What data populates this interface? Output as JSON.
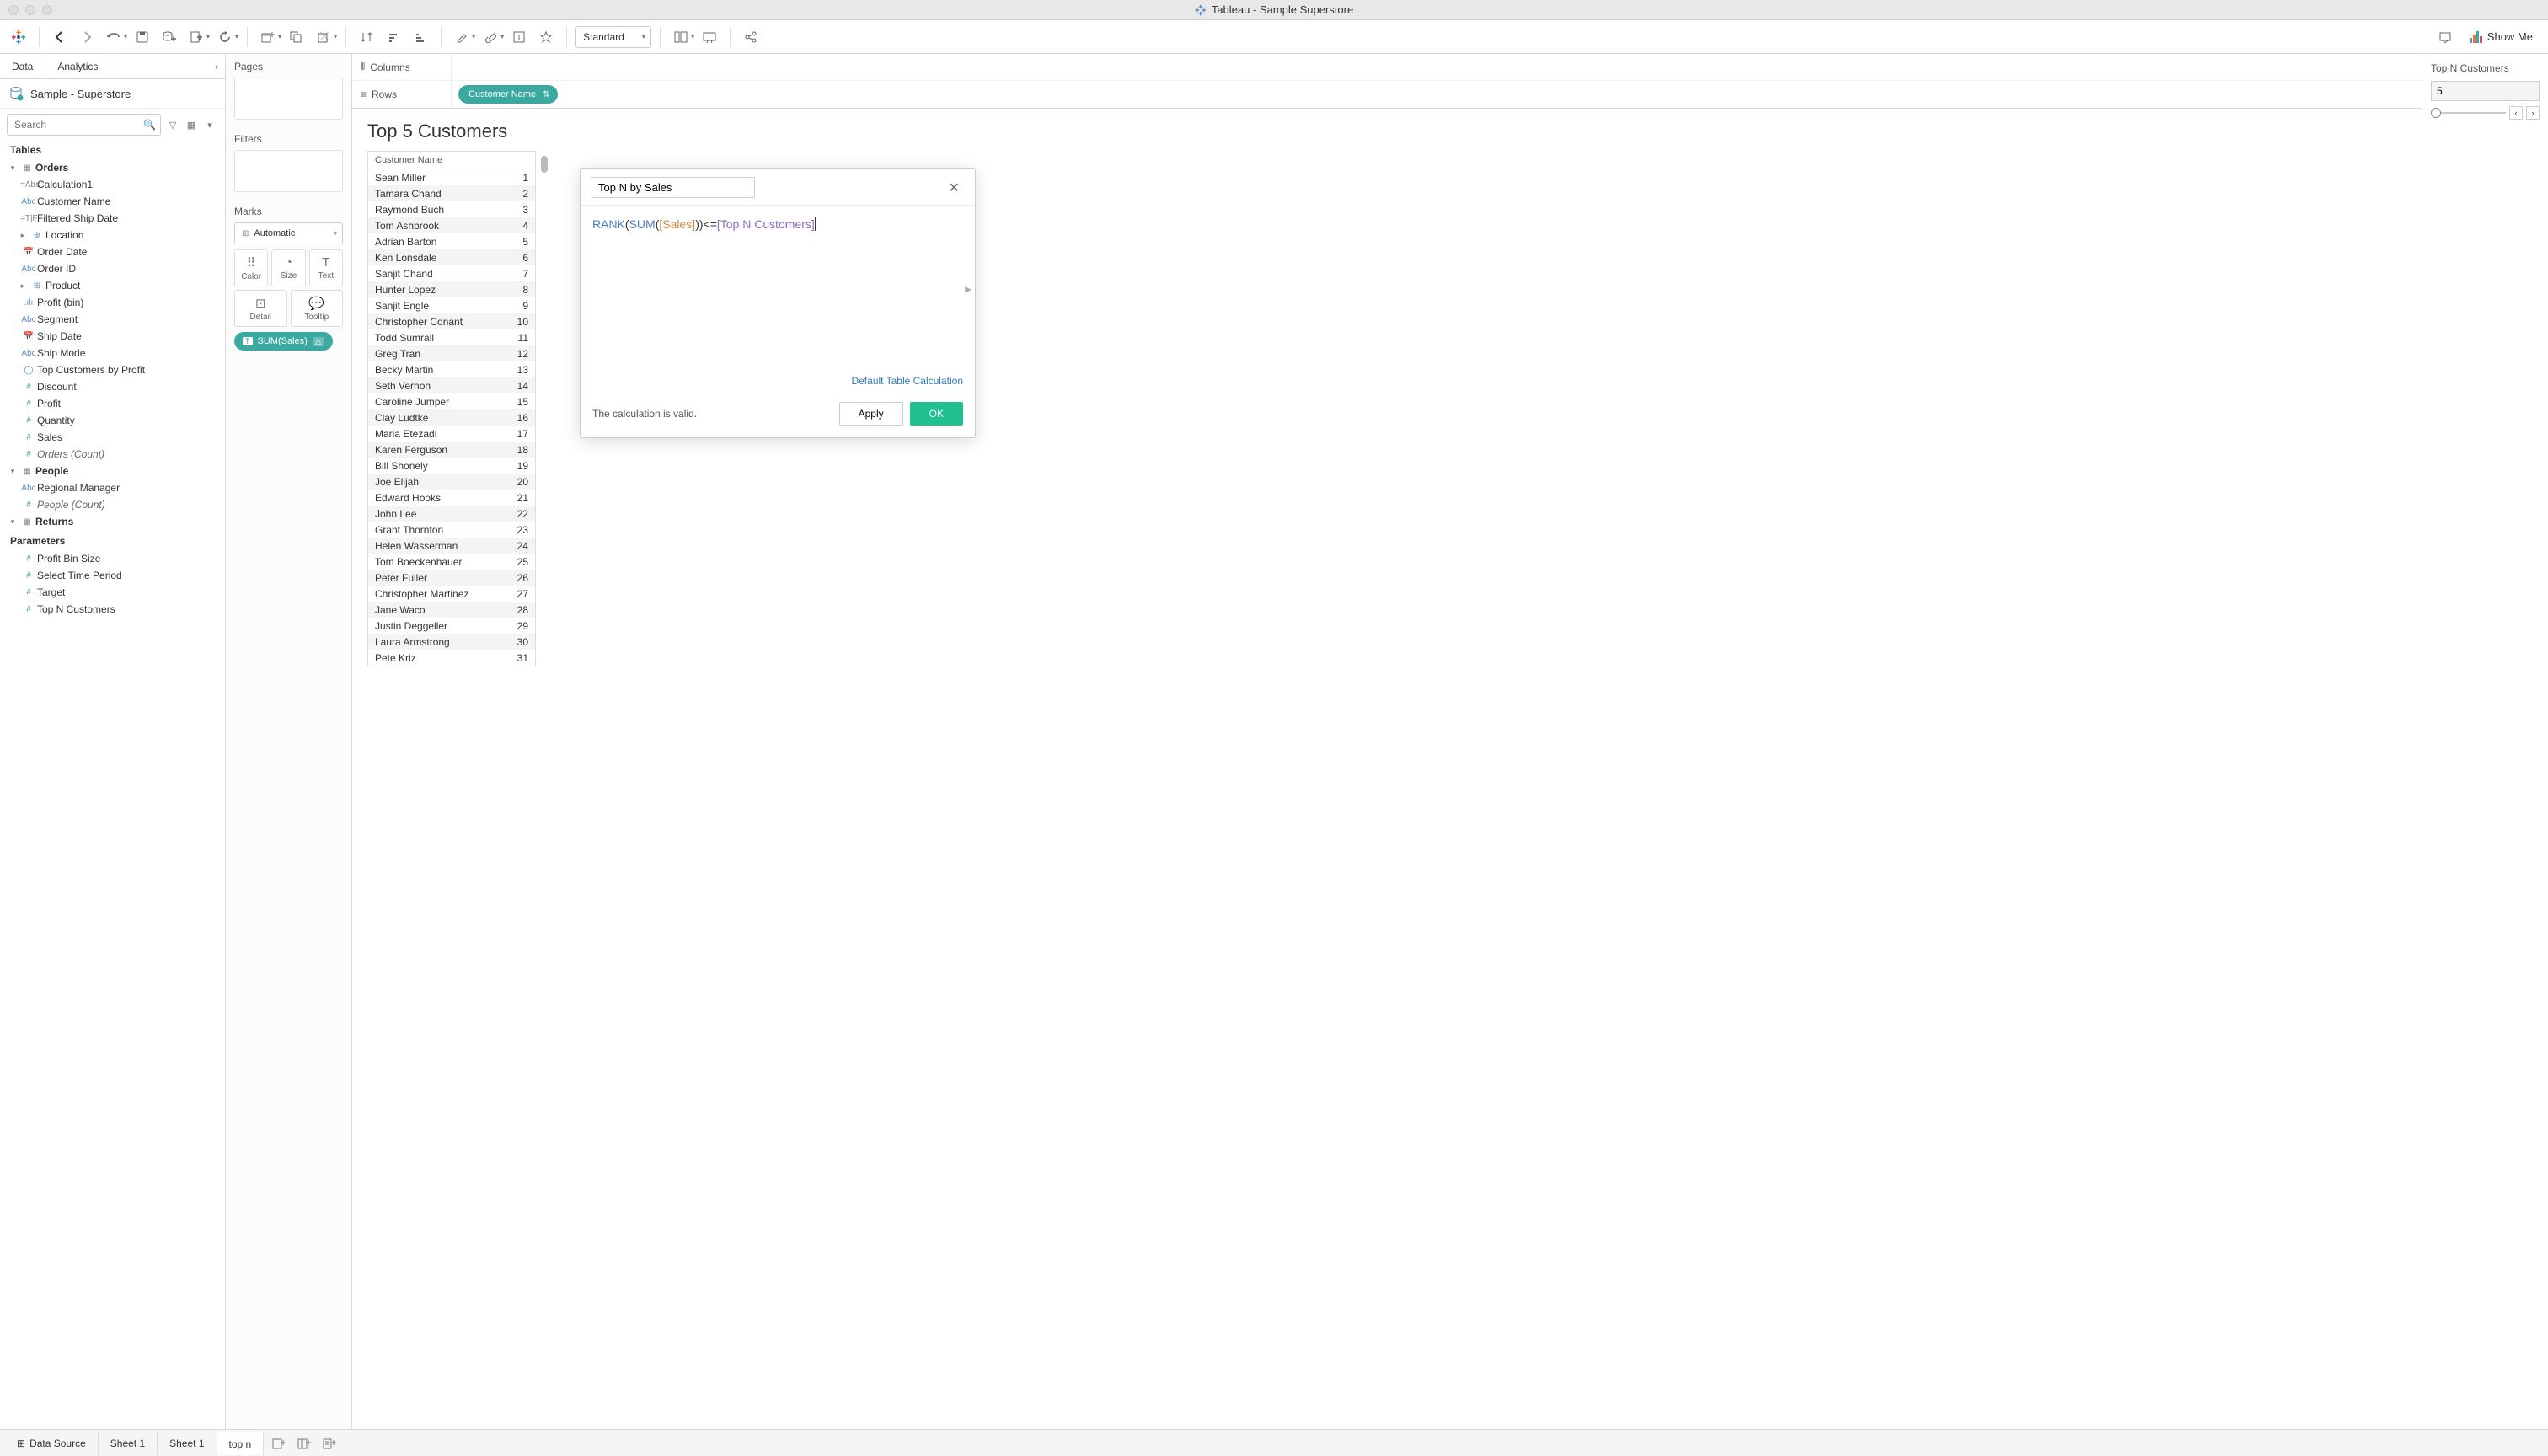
{
  "window": {
    "title": "Tableau - Sample Superstore"
  },
  "toolbar": {
    "fit_mode": "Standard",
    "showme_label": "Show Me"
  },
  "sidebar": {
    "tabs": {
      "data": "Data",
      "analytics": "Analytics"
    },
    "datasource": "Sample - Superstore",
    "search_placeholder": "Search",
    "tables_header": "Tables",
    "tables": [
      {
        "name": "Orders",
        "fields": [
          {
            "label": "Calculation1",
            "icon": "=Abc",
            "cls": "icon-calc"
          },
          {
            "label": "Customer Name",
            "icon": "Abc",
            "cls": "icon-dim"
          },
          {
            "label": "Filtered Ship Date",
            "icon": "=T|F",
            "cls": "icon-calc"
          },
          {
            "label": "Location",
            "icon": "⊕",
            "cls": "icon-dim",
            "caret": true
          },
          {
            "label": "Order Date",
            "icon": "📅",
            "cls": "icon-dim"
          },
          {
            "label": "Order ID",
            "icon": "Abc",
            "cls": "icon-dim"
          },
          {
            "label": "Product",
            "icon": "⊞",
            "cls": "icon-dim",
            "caret": true
          },
          {
            "label": "Profit (bin)",
            "icon": ".ılı",
            "cls": "icon-dim"
          },
          {
            "label": "Segment",
            "icon": "Abc",
            "cls": "icon-dim"
          },
          {
            "label": "Ship Date",
            "icon": "📅",
            "cls": "icon-dim"
          },
          {
            "label": "Ship Mode",
            "icon": "Abc",
            "cls": "icon-dim"
          },
          {
            "label": "Top Customers by Profit",
            "icon": "◯",
            "cls": "icon-dim"
          },
          {
            "label": "Discount",
            "icon": "#",
            "cls": "icon-meas"
          },
          {
            "label": "Profit",
            "icon": "#",
            "cls": "icon-meas"
          },
          {
            "label": "Quantity",
            "icon": "#",
            "cls": "icon-meas"
          },
          {
            "label": "Sales",
            "icon": "#",
            "cls": "icon-meas"
          },
          {
            "label": "Orders (Count)",
            "icon": "#",
            "cls": "icon-meas",
            "italic": true
          }
        ]
      },
      {
        "name": "People",
        "fields": [
          {
            "label": "Regional Manager",
            "icon": "Abc",
            "cls": "icon-dim"
          },
          {
            "label": "People (Count)",
            "icon": "#",
            "cls": "icon-meas",
            "italic": true
          }
        ]
      },
      {
        "name": "Returns",
        "fields": []
      }
    ],
    "parameters_header": "Parameters",
    "parameters": [
      {
        "label": "Profit Bin Size",
        "icon": "#"
      },
      {
        "label": "Select Time Period",
        "icon": "#"
      },
      {
        "label": "Target",
        "icon": "#"
      },
      {
        "label": "Top N Customers",
        "icon": "#"
      }
    ]
  },
  "shelves": {
    "pages": "Pages",
    "filters": "Filters",
    "marks": "Marks",
    "marks_type": "Automatic",
    "mark_cells": [
      "Color",
      "Size",
      "Text",
      "Detail",
      "Tooltip"
    ],
    "marks_pill": "SUM(Sales)",
    "columns": "Columns",
    "rows": "Rows",
    "rows_pill": "Customer Name"
  },
  "viz": {
    "title": "Top 5 Customers",
    "column_header": "Customer Name",
    "rows": [
      {
        "name": "Sean Miller",
        "rank": 1
      },
      {
        "name": "Tamara Chand",
        "rank": 2
      },
      {
        "name": "Raymond Buch",
        "rank": 3
      },
      {
        "name": "Tom Ashbrook",
        "rank": 4
      },
      {
        "name": "Adrian Barton",
        "rank": 5
      },
      {
        "name": "Ken Lonsdale",
        "rank": 6
      },
      {
        "name": "Sanjit Chand",
        "rank": 7
      },
      {
        "name": "Hunter Lopez",
        "rank": 8
      },
      {
        "name": "Sanjit Engle",
        "rank": 9
      },
      {
        "name": "Christopher Conant",
        "rank": 10
      },
      {
        "name": "Todd Sumrall",
        "rank": 11
      },
      {
        "name": "Greg Tran",
        "rank": 12
      },
      {
        "name": "Becky Martin",
        "rank": 13
      },
      {
        "name": "Seth Vernon",
        "rank": 14
      },
      {
        "name": "Caroline Jumper",
        "rank": 15
      },
      {
        "name": "Clay Ludtke",
        "rank": 16
      },
      {
        "name": "Maria Etezadi",
        "rank": 17
      },
      {
        "name": "Karen Ferguson",
        "rank": 18
      },
      {
        "name": "Bill Shonely",
        "rank": 19
      },
      {
        "name": "Joe Elijah",
        "rank": 20
      },
      {
        "name": "Edward Hooks",
        "rank": 21
      },
      {
        "name": "John Lee",
        "rank": 22
      },
      {
        "name": "Grant Thornton",
        "rank": 23
      },
      {
        "name": "Helen Wasserman",
        "rank": 24
      },
      {
        "name": "Tom Boeckenhauer",
        "rank": 25
      },
      {
        "name": "Peter Fuller",
        "rank": 26
      },
      {
        "name": "Christopher Martinez",
        "rank": 27
      },
      {
        "name": "Jane Waco",
        "rank": 28
      },
      {
        "name": "Justin Deggeller",
        "rank": 29
      },
      {
        "name": "Laura Armstrong",
        "rank": 30
      },
      {
        "name": "Pete Kriz",
        "rank": 31
      }
    ]
  },
  "calc_dialog": {
    "name": "Top N by Sales",
    "formula_parts": {
      "rank": "RANK",
      "p1": "(",
      "sum": "SUM",
      "p2": "(",
      "sales": "[Sales]",
      "p3": "))<=",
      "topn": "[Top N Customers]"
    },
    "link": "Default Table Calculation",
    "status": "The calculation is valid.",
    "apply": "Apply",
    "ok": "OK"
  },
  "right_panel": {
    "title": "Top N Customers",
    "value": "5"
  },
  "bottom": {
    "data_source": "Data Source",
    "sheets": [
      "Sheet 1",
      "Sheet 1",
      "top n"
    ]
  }
}
